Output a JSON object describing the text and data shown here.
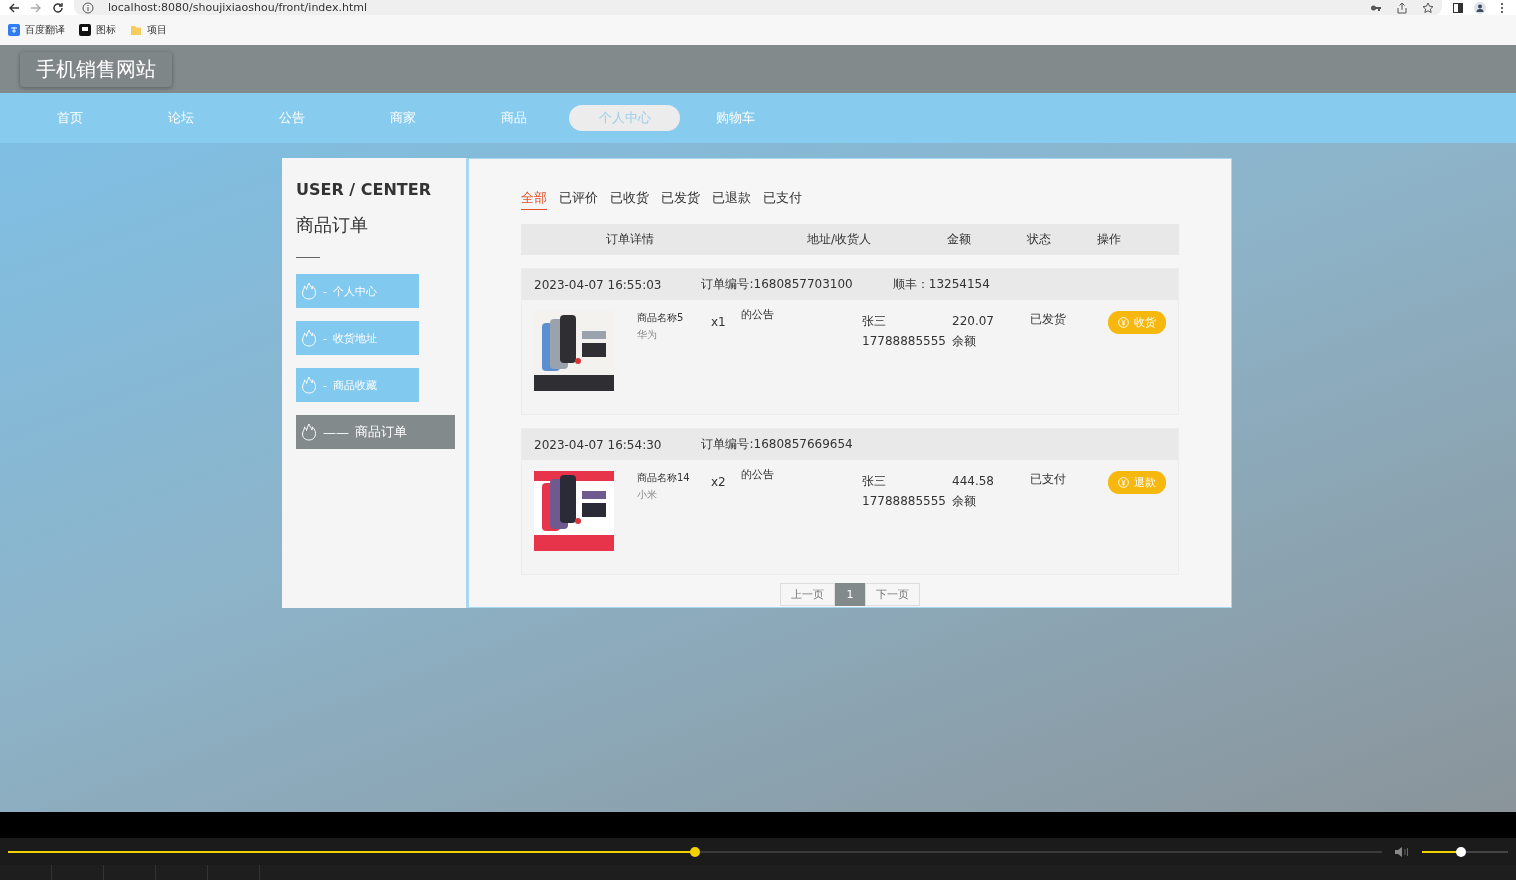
{
  "browser": {
    "url": "localhost:8080/shoujixiaoshou/front/index.html",
    "bookmarks": [
      {
        "label": "百度翻译",
        "kind": "translate"
      },
      {
        "label": "图标",
        "kind": "flag"
      },
      {
        "label": "项目",
        "kind": "folder"
      }
    ]
  },
  "site_title": "手机销售网站",
  "nav": [
    {
      "label": "首页",
      "selected": false
    },
    {
      "label": "论坛",
      "selected": false
    },
    {
      "label": "公告",
      "selected": false
    },
    {
      "label": "商家",
      "selected": false
    },
    {
      "label": "商品",
      "selected": false
    },
    {
      "label": "个人中心",
      "selected": true
    },
    {
      "label": "购物车",
      "selected": false
    }
  ],
  "sidebar": {
    "heading": "USER / CENTER",
    "title": "商品订单",
    "items": [
      {
        "dash": "-",
        "label": "个人中心",
        "selected": false
      },
      {
        "dash": "-",
        "label": "收货地址",
        "selected": false
      },
      {
        "dash": "-",
        "label": "商品收藏",
        "selected": false
      },
      {
        "dash": "——",
        "label": "商品订单",
        "selected": true
      }
    ]
  },
  "tabs": [
    {
      "label": "全部",
      "selected": true
    },
    {
      "label": "已评价",
      "selected": false
    },
    {
      "label": "已收货",
      "selected": false
    },
    {
      "label": "已发货",
      "selected": false
    },
    {
      "label": "已退款",
      "selected": false
    },
    {
      "label": "已支付",
      "selected": false
    }
  ],
  "table": {
    "columns": [
      "订单详情",
      "地址/收货人",
      "金额",
      "状态",
      "操作"
    ]
  },
  "orders": [
    {
      "time": "2023-04-07 16:55:03",
      "order_no": "订单编号:1680857703100",
      "courier": "顺丰：13254154",
      "product": "商品名称5",
      "brand": "华为",
      "qty": "x1",
      "note": "的公告",
      "receiver": "张三",
      "phone": "17788885555",
      "amount": "220.07",
      "payment": "余额",
      "status": "已发货",
      "action": "收货"
    },
    {
      "time": "2023-04-07 16:54:30",
      "order_no": "订单编号:1680857669654",
      "product": "商品名称14",
      "brand": "小米",
      "qty": "x2",
      "note": "的公告",
      "receiver": "张三",
      "phone": "17788885555",
      "amount": "444.58",
      "payment": "余额",
      "status": "已支付",
      "action": "退款"
    }
  ],
  "pagination": {
    "prev": "上一页",
    "pages": [
      {
        "label": "1",
        "selected": true
      }
    ],
    "next": "下一页"
  },
  "player": {
    "progress": {
      "level": 0.5
    },
    "volume": {
      "level": 0.45
    }
  }
}
